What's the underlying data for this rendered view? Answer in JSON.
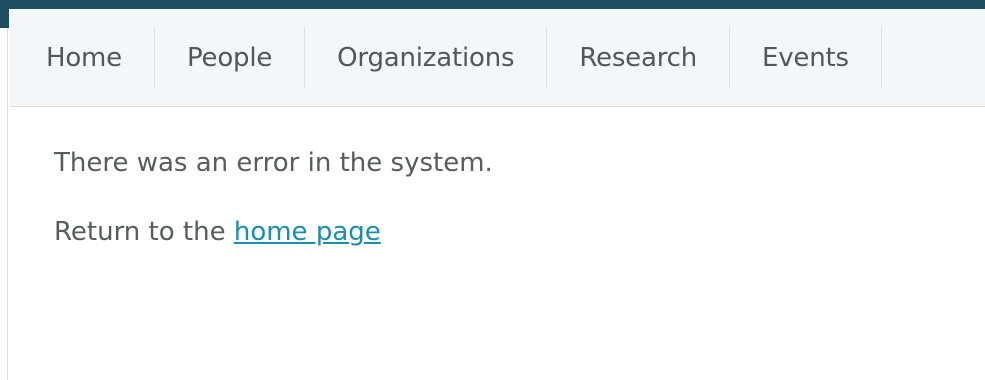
{
  "nav": {
    "items": [
      {
        "label": "Home"
      },
      {
        "label": "People"
      },
      {
        "label": "Organizations"
      },
      {
        "label": "Research"
      },
      {
        "label": "Events"
      }
    ]
  },
  "content": {
    "error_message": "There was an error in the system.",
    "return_prefix": "Return to the",
    "home_link_label": "home page"
  },
  "colors": {
    "nav_background": "#f4f7f8",
    "header_accent": "#1f4f62",
    "link": "#1b8db1",
    "text": "#595b5d"
  }
}
